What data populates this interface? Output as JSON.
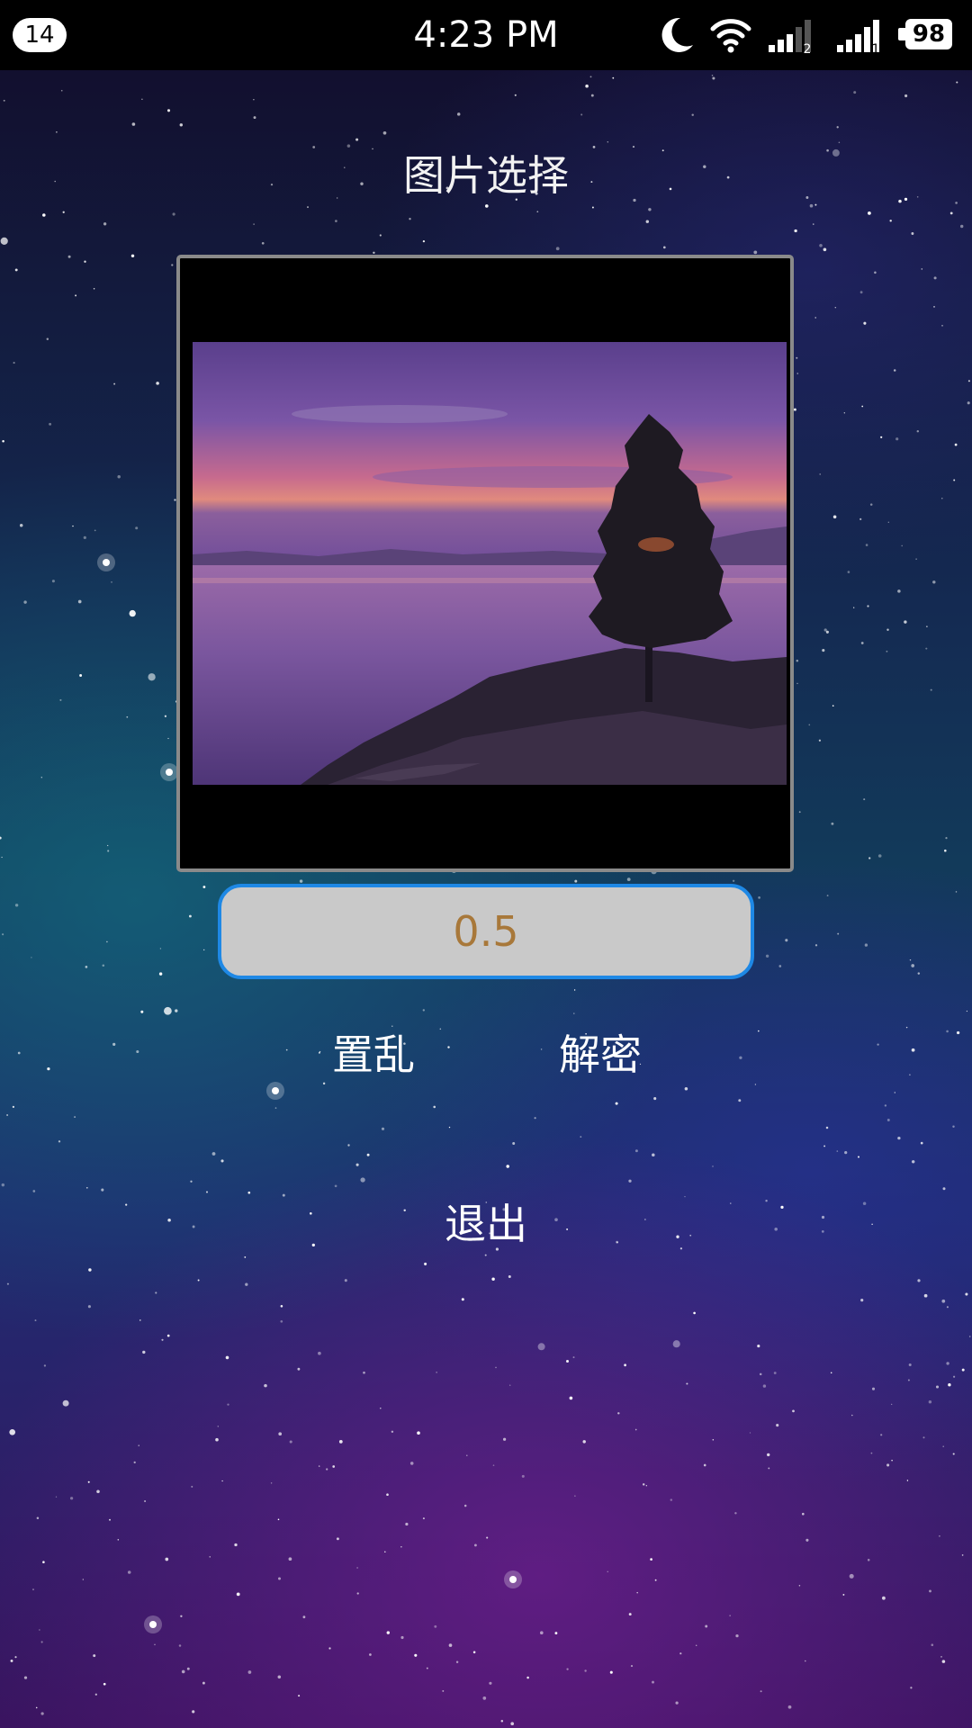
{
  "status_bar": {
    "notification_count": "14",
    "time": "4:23 PM",
    "battery_level": "98",
    "sim2_label": "2",
    "sim1_label": "1",
    "icons": [
      "notification-count-badge",
      "moon-icon",
      "wifi-icon",
      "signal-sim2-icon",
      "signal-sim1-icon",
      "battery-icon"
    ]
  },
  "main": {
    "title": "图片选择",
    "ratio_value": "0.5",
    "scramble_label": "置乱",
    "decrypt_label": "解密",
    "exit_label": "退出"
  },
  "colors": {
    "input_border": "#1e88e5",
    "input_bg": "#c9c9c9",
    "input_text": "#a8783a",
    "frame_border": "#8a8a8a",
    "text": "#ffffff"
  }
}
